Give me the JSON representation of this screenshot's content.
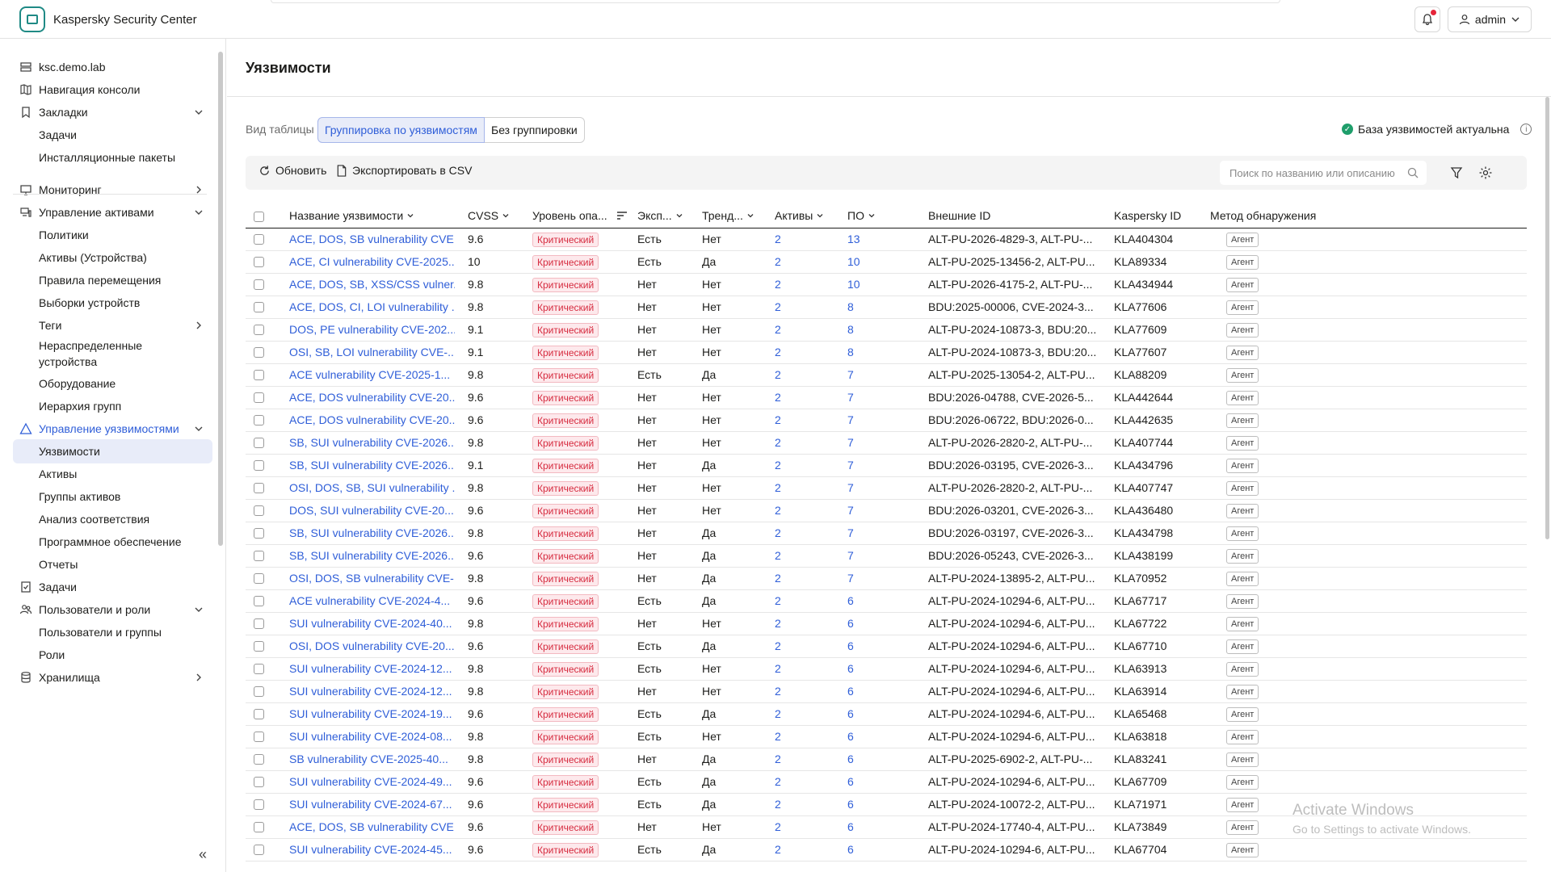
{
  "app": {
    "title": "Kaspersky Security Center",
    "user": "admin"
  },
  "sidebar": {
    "items": [
      {
        "label": "ksc.demo.lab",
        "icon": "server-icon",
        "level": 0,
        "chev": ""
      },
      {
        "label": "Навигация консоли",
        "icon": "map-icon",
        "level": 0,
        "chev": ""
      },
      {
        "label": "Закладки",
        "icon": "bookmark-icon",
        "level": 0,
        "chev": "down"
      },
      {
        "label": "Задачи",
        "icon": "",
        "level": 1,
        "chev": ""
      },
      {
        "label": "Инсталляционные пакеты",
        "icon": "",
        "level": 1,
        "chev": ""
      },
      {
        "label": "Мониторинг",
        "icon": "monitor-icon",
        "level": 0,
        "chev": "right"
      },
      {
        "label": "Управление активами",
        "icon": "devices-icon",
        "level": 0,
        "chev": "down"
      },
      {
        "label": "Политики",
        "icon": "",
        "level": 1,
        "chev": ""
      },
      {
        "label": "Активы (Устройства)",
        "icon": "",
        "level": 1,
        "chev": ""
      },
      {
        "label": "Правила перемещения",
        "icon": "",
        "level": 1,
        "chev": ""
      },
      {
        "label": "Выборки устройств",
        "icon": "",
        "level": 1,
        "chev": ""
      },
      {
        "label": "Теги",
        "icon": "",
        "level": 1,
        "chev": "right"
      },
      {
        "label": "Нераспределенные устройства",
        "icon": "",
        "level": 1,
        "chev": ""
      },
      {
        "label": "Оборудование",
        "icon": "",
        "level": 1,
        "chev": ""
      },
      {
        "label": "Иерархия групп",
        "icon": "",
        "level": 1,
        "chev": ""
      },
      {
        "label": "Управление уязвимостями",
        "icon": "warning-triangle-icon",
        "level": 0,
        "chev": "down"
      },
      {
        "label": "Уязвимости",
        "icon": "",
        "level": 1,
        "chev": ""
      },
      {
        "label": "Активы",
        "icon": "",
        "level": 1,
        "chev": ""
      },
      {
        "label": "Группы активов",
        "icon": "",
        "level": 1,
        "chev": ""
      },
      {
        "label": "Анализ соответствия",
        "icon": "",
        "level": 1,
        "chev": ""
      },
      {
        "label": "Программное обеспечение",
        "icon": "",
        "level": 1,
        "chev": ""
      },
      {
        "label": "Отчеты",
        "icon": "",
        "level": 1,
        "chev": ""
      },
      {
        "label": "Задачи",
        "icon": "task-icon",
        "level": 0,
        "chev": ""
      },
      {
        "label": "Пользователи и роли",
        "icon": "users-icon",
        "level": 0,
        "chev": "down"
      },
      {
        "label": "Пользователи и группы",
        "icon": "",
        "level": 1,
        "chev": ""
      },
      {
        "label": "Роли",
        "icon": "",
        "level": 1,
        "chev": ""
      },
      {
        "label": "Хранилища",
        "icon": "database-icon",
        "level": 0,
        "chev": "right"
      }
    ],
    "collapse_glyph": "«"
  },
  "page": {
    "title": "Уязвимости",
    "view_label": "Вид таблицы",
    "view_options": [
      "Группировка по уязвимостям",
      "Без группировки"
    ],
    "db_status": "База уязвимостей актуальна",
    "toolbar": {
      "refresh": "Обновить",
      "export": "Экспортировать в CSV",
      "search_placeholder": "Поиск по названию или описанию"
    }
  },
  "table": {
    "columns": [
      "Название уязвимости",
      "CVSS",
      "Уровень опа...",
      "Эксп...",
      "Тренд...",
      "Активы",
      "ПО",
      "Внешние ID",
      "Kaspersky ID",
      "Метод обнаружения"
    ],
    "severity_label": "Критический",
    "method_label": "Агент",
    "rows": [
      [
        "ACE, DOS, SB vulnerability CVE...",
        "9.6",
        "Есть",
        "Нет",
        "2",
        "13",
        "ALT-PU-2026-4829-3, ALT-PU-...",
        "KLA404304"
      ],
      [
        "ACE, CI vulnerability CVE-2025...",
        "10",
        "Есть",
        "Да",
        "2",
        "10",
        "ALT-PU-2025-13456-2, ALT-PU...",
        "KLA89334"
      ],
      [
        "ACE, DOS, SB, XSS/CSS vulner...",
        "9.8",
        "Нет",
        "Нет",
        "2",
        "10",
        "ALT-PU-2026-4175-2, ALT-PU-...",
        "KLA434944"
      ],
      [
        "ACE, DOS, CI, LOI vulnerability ...",
        "9.8",
        "Нет",
        "Нет",
        "2",
        "8",
        "BDU:2025-00006, CVE-2024-3...",
        "KLA77606"
      ],
      [
        "DOS, PE vulnerability CVE-202...",
        "9.1",
        "Нет",
        "Нет",
        "2",
        "8",
        "ALT-PU-2024-10873-3, BDU:20...",
        "KLA77609"
      ],
      [
        "OSI, SB, LOI vulnerability CVE-...",
        "9.1",
        "Нет",
        "Нет",
        "2",
        "8",
        "ALT-PU-2024-10873-3, BDU:20...",
        "KLA77607"
      ],
      [
        "ACE vulnerability CVE-2025-1...",
        "9.8",
        "Есть",
        "Да",
        "2",
        "7",
        "ALT-PU-2025-13054-2, ALT-PU...",
        "KLA88209"
      ],
      [
        "ACE, DOS vulnerability CVE-20...",
        "9.6",
        "Нет",
        "Нет",
        "2",
        "7",
        "BDU:2026-04788, CVE-2026-5...",
        "KLA442644"
      ],
      [
        "ACE, DOS vulnerability CVE-20...",
        "9.6",
        "Нет",
        "Нет",
        "2",
        "7",
        "BDU:2026-06722, BDU:2026-0...",
        "KLA442635"
      ],
      [
        "SB, SUI vulnerability CVE-2026...",
        "9.8",
        "Нет",
        "Нет",
        "2",
        "7",
        "ALT-PU-2026-2820-2, ALT-PU-...",
        "KLA407744"
      ],
      [
        "SB, SUI vulnerability CVE-2026...",
        "9.1",
        "Нет",
        "Да",
        "2",
        "7",
        "BDU:2026-03195, CVE-2026-3...",
        "KLA434796"
      ],
      [
        "OSI, DOS, SB, SUI vulnerability ...",
        "9.8",
        "Нет",
        "Нет",
        "2",
        "7",
        "ALT-PU-2026-2820-2, ALT-PU-...",
        "KLA407747"
      ],
      [
        "DOS, SUI vulnerability CVE-20...",
        "9.6",
        "Нет",
        "Нет",
        "2",
        "7",
        "BDU:2026-03201, CVE-2026-3...",
        "KLA436480"
      ],
      [
        "SB, SUI vulnerability CVE-2026...",
        "9.8",
        "Нет",
        "Да",
        "2",
        "7",
        "BDU:2026-03197, CVE-2026-3...",
        "KLA434798"
      ],
      [
        "SB, SUI vulnerability CVE-2026...",
        "9.6",
        "Нет",
        "Да",
        "2",
        "7",
        "BDU:2026-05243, CVE-2026-3...",
        "KLA438199"
      ],
      [
        "OSI, DOS, SB vulnerability CVE-...",
        "9.8",
        "Нет",
        "Да",
        "2",
        "7",
        "ALT-PU-2024-13895-2, ALT-PU...",
        "KLA70952"
      ],
      [
        "ACE vulnerability CVE-2024-4...",
        "9.6",
        "Есть",
        "Да",
        "2",
        "6",
        "ALT-PU-2024-10294-6, ALT-PU...",
        "KLA67717"
      ],
      [
        "SUI vulnerability CVE-2024-40...",
        "9.8",
        "Нет",
        "Нет",
        "2",
        "6",
        "ALT-PU-2024-10294-6, ALT-PU...",
        "KLA67722"
      ],
      [
        "OSI, DOS vulnerability CVE-20...",
        "9.6",
        "Есть",
        "Да",
        "2",
        "6",
        "ALT-PU-2024-10294-6, ALT-PU...",
        "KLA67710"
      ],
      [
        "SUI vulnerability CVE-2024-12...",
        "9.8",
        "Есть",
        "Нет",
        "2",
        "6",
        "ALT-PU-2024-10294-6, ALT-PU...",
        "KLA63913"
      ],
      [
        "SUI vulnerability CVE-2024-12...",
        "9.8",
        "Нет",
        "Нет",
        "2",
        "6",
        "ALT-PU-2024-10294-6, ALT-PU...",
        "KLA63914"
      ],
      [
        "SUI vulnerability CVE-2024-19...",
        "9.6",
        "Есть",
        "Да",
        "2",
        "6",
        "ALT-PU-2024-10294-6, ALT-PU...",
        "KLA65468"
      ],
      [
        "SUI vulnerability CVE-2024-08...",
        "9.8",
        "Есть",
        "Нет",
        "2",
        "6",
        "ALT-PU-2024-10294-6, ALT-PU...",
        "KLA63818"
      ],
      [
        "SB vulnerability CVE-2025-40...",
        "9.8",
        "Нет",
        "Да",
        "2",
        "6",
        "ALT-PU-2025-6902-2, ALT-PU-...",
        "KLA83241"
      ],
      [
        "SUI vulnerability CVE-2024-49...",
        "9.6",
        "Есть",
        "Да",
        "2",
        "6",
        "ALT-PU-2024-10294-6, ALT-PU...",
        "KLA67709"
      ],
      [
        "SUI vulnerability CVE-2024-67...",
        "9.6",
        "Есть",
        "Да",
        "2",
        "6",
        "ALT-PU-2024-10072-2, ALT-PU...",
        "KLA71971"
      ],
      [
        "ACE, DOS, SB vulnerability CVE...",
        "9.6",
        "Нет",
        "Нет",
        "2",
        "6",
        "ALT-PU-2024-17740-4, ALT-PU...",
        "KLA73849"
      ],
      [
        "SUI vulnerability CVE-2024-45...",
        "9.6",
        "Есть",
        "Да",
        "2",
        "6",
        "ALT-PU-2024-10294-6, ALT-PU...",
        "KLA67704"
      ]
    ]
  },
  "watermark": {
    "line1": "Activate Windows",
    "line2": "Go to Settings to activate Windows."
  },
  "colors": {
    "accent": "#2f5ed8",
    "critical": "#d62b3f",
    "ok": "#1f9e6b",
    "brand": "#1f8a85"
  }
}
